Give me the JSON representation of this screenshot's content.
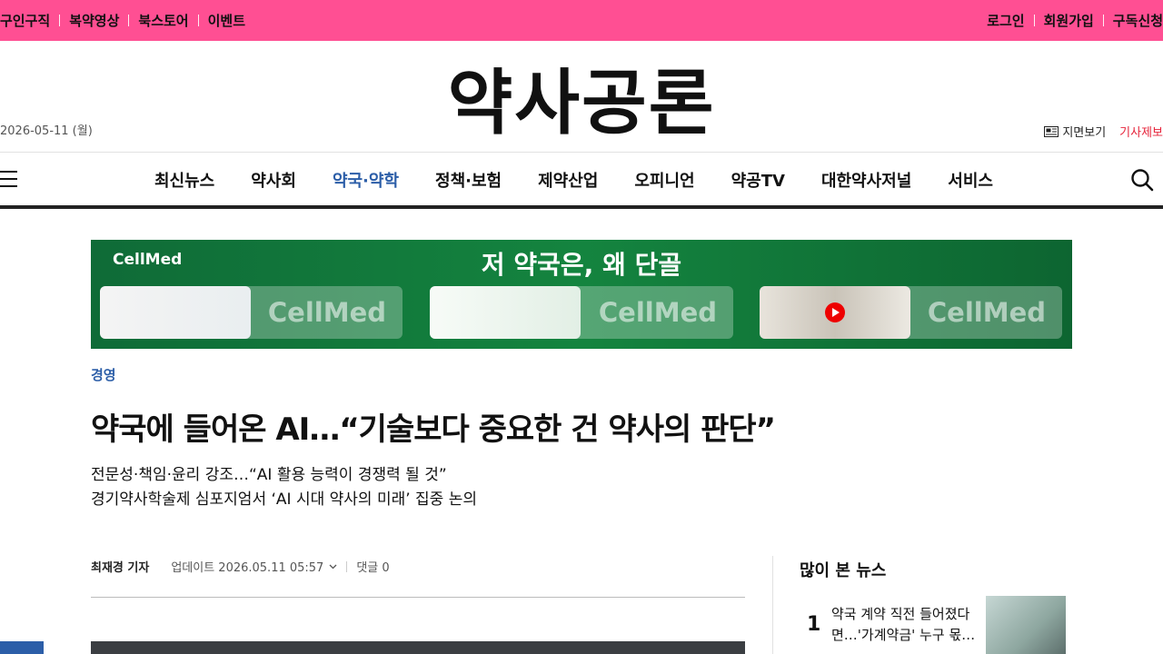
{
  "topbar": {
    "left": [
      "구인구직",
      "복약영상",
      "북스토어",
      "이벤트"
    ],
    "right": [
      "로그인",
      "회원가입",
      "구독신청"
    ]
  },
  "header": {
    "date": "2026-05-11 (월)",
    "logo": "약사공론",
    "paper_view": "지면보기",
    "report": "기사제보"
  },
  "nav": {
    "items": [
      "최신뉴스",
      "약사회",
      "약국·약학",
      "정책·보험",
      "제약산업",
      "오피니언",
      "약공TV",
      "대한약사저널",
      "서비스"
    ],
    "active": "약국·약학"
  },
  "banner": {
    "brand": "CellMed",
    "headline": "저 약국은, 왜 단골",
    "watermark": "CellMed"
  },
  "article": {
    "section": "경영",
    "title": "약국에 들어온 AI…“기술보다 중요한 건 약사의 판단”",
    "subtitle_1": "전문성·책임·윤리 강조…“AI 활용 능력이 경쟁력 될 것”",
    "subtitle_2": "경기약사학술제 심포지엄서 ‘AI 시대 약사의 미래’ 집중 논의",
    "reporter": "최재경 기자",
    "updated": "업데이트 2026.05.11 05:57",
    "comments": "댓글 0"
  },
  "sidebar": {
    "popular_title": "많이 본 뉴스",
    "items": [
      {
        "rank": "1",
        "title": "약국 계약 직전 들어졌다면…'가계약금' 누구 몫…"
      }
    ]
  }
}
